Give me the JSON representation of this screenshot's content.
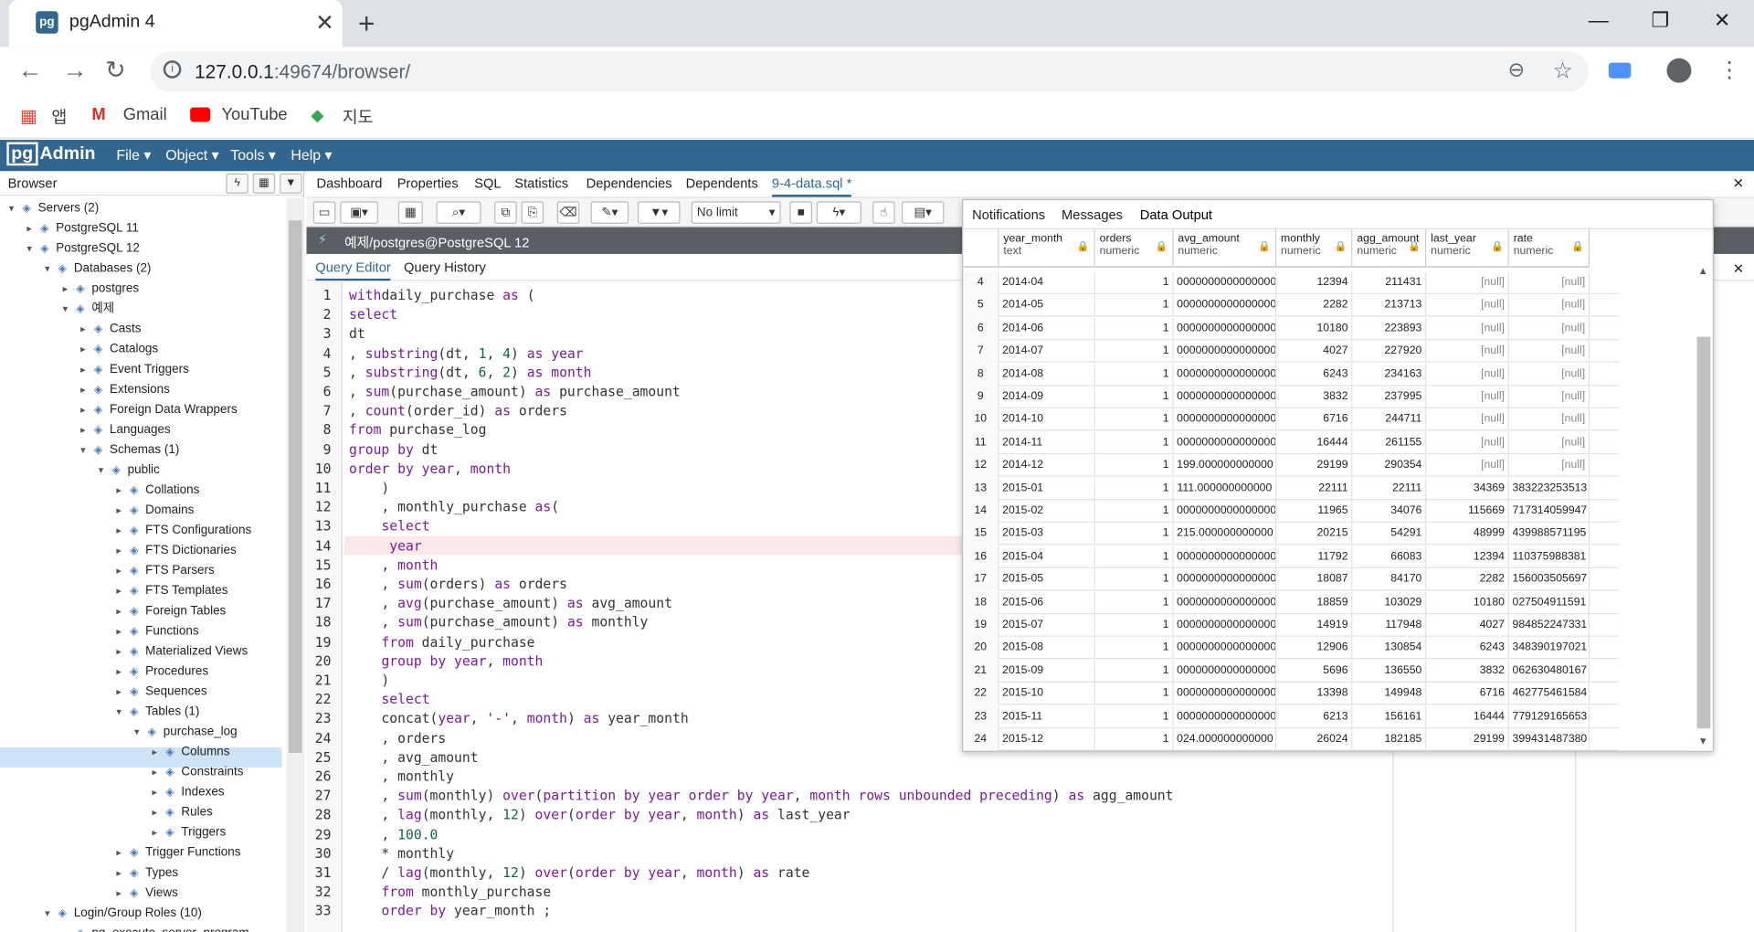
{
  "browser_tab": {
    "title": "pgAdmin 4",
    "favicon": "pg"
  },
  "omnibox": {
    "host": "127.0.0.1",
    "rest": ":49674/browser/"
  },
  "bookmarks": [
    "앱",
    "Gmail",
    "YouTube",
    "지도"
  ],
  "pgadmin": {
    "logo": "Admin",
    "logo_pg": "pg",
    "menu": [
      "File ▾",
      "Object ▾",
      "Tools ▾",
      "Help ▾"
    ]
  },
  "browser_panel": {
    "title": "Browser",
    "tree": [
      {
        "label": "Servers (2)",
        "icon": "servers-icon"
      },
      {
        "label": "PostgreSQL 11",
        "icon": "server-icon"
      },
      {
        "label": "PostgreSQL 12",
        "icon": "server-icon"
      },
      {
        "label": "Databases (2)",
        "icon": "databases-icon"
      },
      {
        "label": "postgres",
        "icon": "database-icon"
      },
      {
        "label": "예제",
        "icon": "database-icon"
      },
      {
        "label": "Casts",
        "icon": "casts-icon"
      },
      {
        "label": "Catalogs",
        "icon": "catalogs-icon"
      },
      {
        "label": "Event Triggers",
        "icon": "event-triggers-icon"
      },
      {
        "label": "Extensions",
        "icon": "extensions-icon"
      },
      {
        "label": "Foreign Data Wrappers",
        "icon": "fdw-icon"
      },
      {
        "label": "Languages",
        "icon": "languages-icon"
      },
      {
        "label": "Schemas (1)",
        "icon": "schemas-icon"
      },
      {
        "label": "public",
        "icon": "schema-icon"
      },
      {
        "label": "Collations",
        "icon": "collations-icon"
      },
      {
        "label": "Domains",
        "icon": "domains-icon"
      },
      {
        "label": "FTS Configurations",
        "icon": "fts-config-icon"
      },
      {
        "label": "FTS Dictionaries",
        "icon": "fts-dict-icon"
      },
      {
        "label": "FTS Parsers",
        "icon": "fts-parser-icon"
      },
      {
        "label": "FTS Templates",
        "icon": "fts-template-icon"
      },
      {
        "label": "Foreign Tables",
        "icon": "foreign-table-icon"
      },
      {
        "label": "Functions",
        "icon": "functions-icon"
      },
      {
        "label": "Materialized Views",
        "icon": "matview-icon"
      },
      {
        "label": "Procedures",
        "icon": "procedures-icon"
      },
      {
        "label": "Sequences",
        "icon": "sequences-icon"
      },
      {
        "label": "Tables (1)",
        "icon": "tables-icon"
      },
      {
        "label": "purchase_log",
        "icon": "table-icon"
      },
      {
        "label": "Columns",
        "icon": "columns-icon"
      },
      {
        "label": "Constraints",
        "icon": "constraints-icon"
      },
      {
        "label": "Indexes",
        "icon": "indexes-icon"
      },
      {
        "label": "Rules",
        "icon": "rules-icon"
      },
      {
        "label": "Triggers",
        "icon": "triggers-icon"
      },
      {
        "label": "Trigger Functions",
        "icon": "trigger-functions-icon"
      },
      {
        "label": "Types",
        "icon": "types-icon"
      },
      {
        "label": "Views",
        "icon": "views-icon"
      },
      {
        "label": "Login/Group Roles (10)",
        "icon": "roles-icon"
      },
      {
        "label": "pg_execute_server_program",
        "icon": "role-icon"
      }
    ]
  },
  "main_tabs": [
    "Dashboard",
    "Properties",
    "SQL",
    "Statistics",
    "Dependencies",
    "Dependents",
    "9-4-data.sql *"
  ],
  "toolbar": {
    "limit": "No limit"
  },
  "connection": "예제/postgres@PostgreSQL 12",
  "query_tabs": [
    "Query Editor",
    "Query History"
  ],
  "code_lines": [
    [
      [
        "kw",
        "with"
      ],
      [
        "",
        "daily_purchase "
      ],
      [
        "kw",
        "as"
      ],
      [
        "",
        "",
        " ("
      ]
    ],
    [
      [
        "kw",
        "select"
      ]
    ],
    [
      [
        "",
        "dt"
      ]
    ],
    [
      [
        "",
        ", "
      ],
      [
        "fn",
        "substring"
      ],
      [
        "",
        "(dt, "
      ],
      [
        "nm",
        "1"
      ],
      [
        "",
        ", "
      ],
      [
        "nm",
        "4"
      ],
      [
        "",
        ") "
      ],
      [
        "kw",
        "as"
      ],
      [
        "kw",
        " year"
      ]
    ],
    [
      [
        "",
        ", "
      ],
      [
        "fn",
        "substring"
      ],
      [
        "",
        "(dt, "
      ],
      [
        "nm",
        "6"
      ],
      [
        "",
        ", "
      ],
      [
        "nm",
        "2"
      ],
      [
        "",
        ") "
      ],
      [
        "kw",
        "as"
      ],
      [
        "kw",
        " month"
      ]
    ],
    [
      [
        "",
        ", "
      ],
      [
        "fn",
        "sum"
      ],
      [
        "",
        "(purchase_amount) "
      ],
      [
        "kw",
        "as"
      ],
      [
        "",
        " purchase_amount"
      ]
    ],
    [
      [
        "",
        ", "
      ],
      [
        "fn",
        "count"
      ],
      [
        "",
        "(order_id) "
      ],
      [
        "kw",
        "as"
      ],
      [
        "",
        " orders"
      ]
    ],
    [
      [
        "kw",
        "from"
      ],
      [
        "",
        " purchase_log"
      ]
    ],
    [
      [
        "kw",
        "group by"
      ],
      [
        "",
        " dt"
      ]
    ],
    [
      [
        "kw",
        "order by"
      ],
      [
        "kw",
        " year"
      ],
      [
        "",
        ", "
      ],
      [
        "kw",
        "month"
      ]
    ],
    [
      [
        "",
        "    )"
      ]
    ],
    [
      [
        "",
        "    , monthly_purchase "
      ],
      [
        "kw",
        "as"
      ],
      [
        "",
        "("
      ]
    ],
    [
      [
        "",
        "    "
      ],
      [
        "kw",
        "select"
      ]
    ],
    [
      [
        "",
        "     "
      ],
      [
        "kw",
        "year"
      ]
    ],
    [
      [
        "",
        "    , "
      ],
      [
        "kw",
        "month"
      ]
    ],
    [
      [
        "",
        "    , "
      ],
      [
        "fn",
        "sum"
      ],
      [
        "",
        "(orders) "
      ],
      [
        "kw",
        "as"
      ],
      [
        "",
        " orders"
      ]
    ],
    [
      [
        "",
        "    , "
      ],
      [
        "fn",
        "avg"
      ],
      [
        "",
        "(purchase_amount) "
      ],
      [
        "kw",
        "as"
      ],
      [
        "",
        " avg_amount"
      ]
    ],
    [
      [
        "",
        "    , "
      ],
      [
        "fn",
        "sum"
      ],
      [
        "",
        "(purchase_amount) "
      ],
      [
        "kw",
        "as"
      ],
      [
        "",
        " monthly"
      ]
    ],
    [
      [
        "",
        "    "
      ],
      [
        "kw",
        "from"
      ],
      [
        "",
        " daily_purchase"
      ]
    ],
    [
      [
        "",
        "    "
      ],
      [
        "kw",
        "group by"
      ],
      [
        "kw",
        " year"
      ],
      [
        "",
        ", "
      ],
      [
        "kw",
        "month"
      ]
    ],
    [
      [
        "",
        "    )"
      ]
    ],
    [
      [
        "",
        "    "
      ],
      [
        "kw",
        "select"
      ]
    ],
    [
      [
        "",
        "    concat("
      ],
      [
        "kw",
        "year"
      ],
      [
        "",
        ", "
      ],
      [
        "st",
        "'-'"
      ],
      [
        "",
        ", "
      ],
      [
        "kw",
        "month"
      ],
      [
        "",
        ") "
      ],
      [
        "kw",
        "as"
      ],
      [
        "",
        " year_month"
      ]
    ],
    [
      [
        "",
        "    , orders"
      ]
    ],
    [
      [
        "",
        "    , avg_amount"
      ]
    ],
    [
      [
        "",
        "    , monthly"
      ]
    ],
    [
      [
        "",
        "    , "
      ],
      [
        "fn",
        "sum"
      ],
      [
        "",
        "(monthly) "
      ],
      [
        "kw",
        "over"
      ],
      [
        "",
        "("
      ],
      [
        "kw",
        "partition by"
      ],
      [
        "kw",
        " year"
      ],
      [
        "kw",
        " order by"
      ],
      [
        "kw",
        " year"
      ],
      [
        "",
        ", "
      ],
      [
        "kw",
        "month"
      ],
      [
        "kw",
        " rows unbounded preceding"
      ],
      [
        "",
        ") "
      ],
      [
        "kw",
        "as"
      ],
      [
        "",
        " agg_amount"
      ]
    ],
    [
      [
        "",
        "    , "
      ],
      [
        "fn",
        "lag"
      ],
      [
        "",
        "(monthly, "
      ],
      [
        "nm",
        "12"
      ],
      [
        "",
        ") "
      ],
      [
        "kw",
        "over"
      ],
      [
        "",
        "("
      ],
      [
        "kw",
        "order by"
      ],
      [
        "kw",
        " year"
      ],
      [
        "",
        ", "
      ],
      [
        "kw",
        "month"
      ],
      [
        "",
        ") "
      ],
      [
        "kw",
        "as"
      ],
      [
        "",
        " last_year"
      ]
    ],
    [
      [
        "",
        "    , "
      ],
      [
        "nm",
        "100.0"
      ]
    ],
    [
      [
        "",
        "    * monthly"
      ]
    ],
    [
      [
        "",
        "    / "
      ],
      [
        "fn",
        "lag"
      ],
      [
        "",
        "(monthly, "
      ],
      [
        "nm",
        "12"
      ],
      [
        "",
        ") "
      ],
      [
        "kw",
        "over"
      ],
      [
        "",
        "("
      ],
      [
        "kw",
        "order by"
      ],
      [
        "kw",
        " year"
      ],
      [
        "",
        ", "
      ],
      [
        "kw",
        "month"
      ],
      [
        "",
        ") "
      ],
      [
        "kw",
        "as"
      ],
      [
        "",
        " rate"
      ]
    ],
    [
      [
        "",
        "    "
      ],
      [
        "kw",
        "from"
      ],
      [
        "",
        " monthly_purchase"
      ]
    ],
    [
      [
        "",
        "    "
      ],
      [
        "kw",
        "order by"
      ],
      [
        "",
        " year_month ; "
      ]
    ]
  ],
  "output_tabs": [
    "Notifications",
    "Messages",
    "Data Output"
  ],
  "columns": [
    {
      "name": "year_month",
      "type": "text"
    },
    {
      "name": "orders",
      "type": "numeric"
    },
    {
      "name": "avg_amount",
      "type": "numeric"
    },
    {
      "name": "monthly",
      "type": "numeric"
    },
    {
      "name": "agg_amount",
      "type": "numeric"
    },
    {
      "name": "last_year",
      "type": "numeric"
    },
    {
      "name": "rate",
      "type": "numeric"
    }
  ],
  "rows": [
    [
      "4",
      "2014-04",
      "1",
      "0000000000000000",
      "12394",
      "211431",
      "[null]",
      "[null]"
    ],
    [
      "5",
      "2014-05",
      "1",
      "0000000000000000",
      "2282",
      "213713",
      "[null]",
      "[null]"
    ],
    [
      "6",
      "2014-06",
      "1",
      "0000000000000000",
      "10180",
      "223893",
      "[null]",
      "[null]"
    ],
    [
      "7",
      "2014-07",
      "1",
      "0000000000000000",
      "4027",
      "227920",
      "[null]",
      "[null]"
    ],
    [
      "8",
      "2014-08",
      "1",
      "0000000000000000",
      "6243",
      "234163",
      "[null]",
      "[null]"
    ],
    [
      "9",
      "2014-09",
      "1",
      "0000000000000000",
      "3832",
      "237995",
      "[null]",
      "[null]"
    ],
    [
      "10",
      "2014-10",
      "1",
      "0000000000000000",
      "6716",
      "244711",
      "[null]",
      "[null]"
    ],
    [
      "11",
      "2014-11",
      "1",
      "0000000000000000",
      "16444",
      "261155",
      "[null]",
      "[null]"
    ],
    [
      "12",
      "2014-12",
      "1",
      "199.000000000000",
      "29199",
      "290354",
      "[null]",
      "[null]"
    ],
    [
      "13",
      "2015-01",
      "1",
      "111.000000000000",
      "22111",
      "22111",
      "34369",
      "383223253513"
    ],
    [
      "14",
      "2015-02",
      "1",
      "0000000000000000",
      "11965",
      "34076",
      "115669",
      "717314059947"
    ],
    [
      "15",
      "2015-03",
      "1",
      "215.000000000000",
      "20215",
      "54291",
      "48999",
      "439988571195"
    ],
    [
      "16",
      "2015-04",
      "1",
      "0000000000000000",
      "11792",
      "66083",
      "12394",
      "110375988381"
    ],
    [
      "17",
      "2015-05",
      "1",
      "0000000000000000",
      "18087",
      "84170",
      "2282",
      "156003505697"
    ],
    [
      "18",
      "2015-06",
      "1",
      "0000000000000000",
      "18859",
      "103029",
      "10180",
      "027504911591"
    ],
    [
      "19",
      "2015-07",
      "1",
      "0000000000000000",
      "14919",
      "117948",
      "4027",
      "984852247331"
    ],
    [
      "20",
      "2015-08",
      "1",
      "0000000000000000",
      "12906",
      "130854",
      "6243",
      "348390197021"
    ],
    [
      "21",
      "2015-09",
      "1",
      "0000000000000000",
      "5696",
      "136550",
      "3832",
      "062630480167"
    ],
    [
      "22",
      "2015-10",
      "1",
      "0000000000000000",
      "13398",
      "149948",
      "6716",
      "462775461584"
    ],
    [
      "23",
      "2015-11",
      "1",
      "0000000000000000",
      "6213",
      "156161",
      "16444",
      "779129165653"
    ],
    [
      "24",
      "2015-12",
      "1",
      "024.000000000000",
      "26024",
      "182185",
      "29199",
      "399431487380"
    ]
  ]
}
